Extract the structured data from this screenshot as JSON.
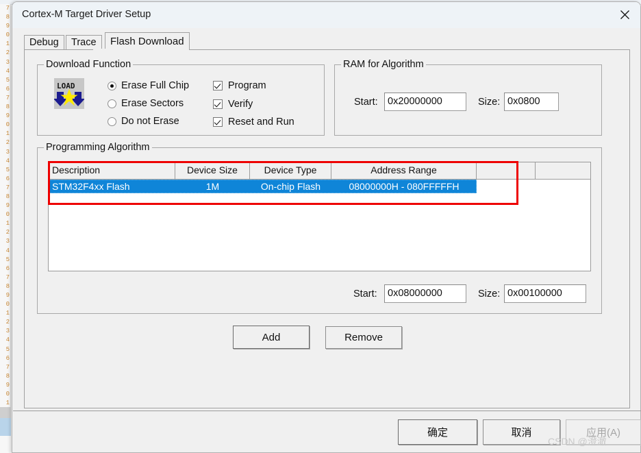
{
  "background": {
    "gutter_line_numbers": "7\n8\n9\n0\n1\n2\n3\n4\n5\n6\n7\n8\n9\n0\n1\n2\n3\n4\n5\n6\n7\n8\n9\n0\n1\n2\n3\n4\n5\n6\n7\n8\n9\n0\n1\n2\n3\n4\n5\n6\n7\n8\n9\n0\n1"
  },
  "window": {
    "title": "Cortex-M Target Driver Setup",
    "close_icon": "close-icon"
  },
  "tabs": [
    {
      "label": "Debug",
      "active": false
    },
    {
      "label": "Trace",
      "active": false
    },
    {
      "label": "Flash Download",
      "active": true
    }
  ],
  "download_function": {
    "group_title": "Download Function",
    "icon": "load-icon",
    "erase_options": [
      {
        "label": "Erase Full Chip",
        "checked": true
      },
      {
        "label": "Erase Sectors",
        "checked": false
      },
      {
        "label": "Do not Erase",
        "checked": false
      }
    ],
    "checkboxes": [
      {
        "label": "Program",
        "checked": true
      },
      {
        "label": "Verify",
        "checked": true
      },
      {
        "label": "Reset and Run",
        "checked": true
      }
    ]
  },
  "ram_for_algorithm": {
    "group_title": "RAM for Algorithm",
    "start_label": "Start:",
    "start_value": "0x20000000",
    "size_label": "Size:",
    "size_value": "0x0800"
  },
  "programming_algorithm": {
    "group_title": "Programming Algorithm",
    "columns": [
      "Description",
      "Device Size",
      "Device Type",
      "Address Range",
      ""
    ],
    "rows": [
      {
        "description": "STM32F4xx Flash",
        "device_size": "1M",
        "device_type": "On-chip Flash",
        "address_range": "08000000H - 080FFFFFH",
        "selected": true
      }
    ],
    "start_label": "Start:",
    "start_value": "0x08000000",
    "size_label": "Size:",
    "size_value": "0x00100000",
    "add_label": "Add",
    "remove_label": "Remove",
    "highlight_color": "#ee0000",
    "selection_color": "#0f85d8"
  },
  "footer": {
    "ok_label": "确定",
    "cancel_label": "取消",
    "apply_label": "应用(A)",
    "apply_disabled": true
  },
  "watermark": {
    "text": "CSDN @澄澈"
  }
}
